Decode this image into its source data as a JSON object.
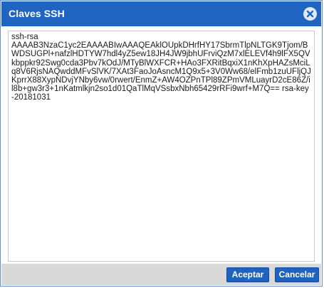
{
  "dialog": {
    "title": "Claves SSH",
    "close_icon": "close-icon",
    "ssh_key_text": "ssh-rsa\nAAAAB3NzaC1yc2EAAAABIwAAAQEAklOUpkDHrfHY17SbrmTlpNLTGK9Tjom/BWDSUGPl+nafzlHDTYW7hdl4yZ5ew18JH4JW9jbhUFrviQzM7xlELEVf4h9lFX5QVkbppkr92Swg0cda3Pbv7kOdJ/MTyBlWXFCR+HAo3FXRitBqxiX1nKhXpHAZsMciLq8V6RjsNAQwddMFvSlVK/7XAt3FaoJoAsncM1Q9x5+3V0Ww68/elFmb1zuUFljQJKprrX88XypNDvjYNby6vw/0rwert/EnmZ+AW4OZPnTPl89ZPmVMLuayrD2cE86Z/il8b+gw3r3+1nKatmlkjn2so1d01QaTlMqVSsbxNbh65429rRFi9wrf+M7Q== rsa-key-20181031"
  },
  "buttons": {
    "accept_label": "Aceptar",
    "cancel_label": "Cancelar"
  },
  "colors": {
    "titlebar": "#1e64c0",
    "button": "#1f63bf",
    "footer": "#d9d9d9",
    "close_icon_bg": "#dfe8f6"
  }
}
